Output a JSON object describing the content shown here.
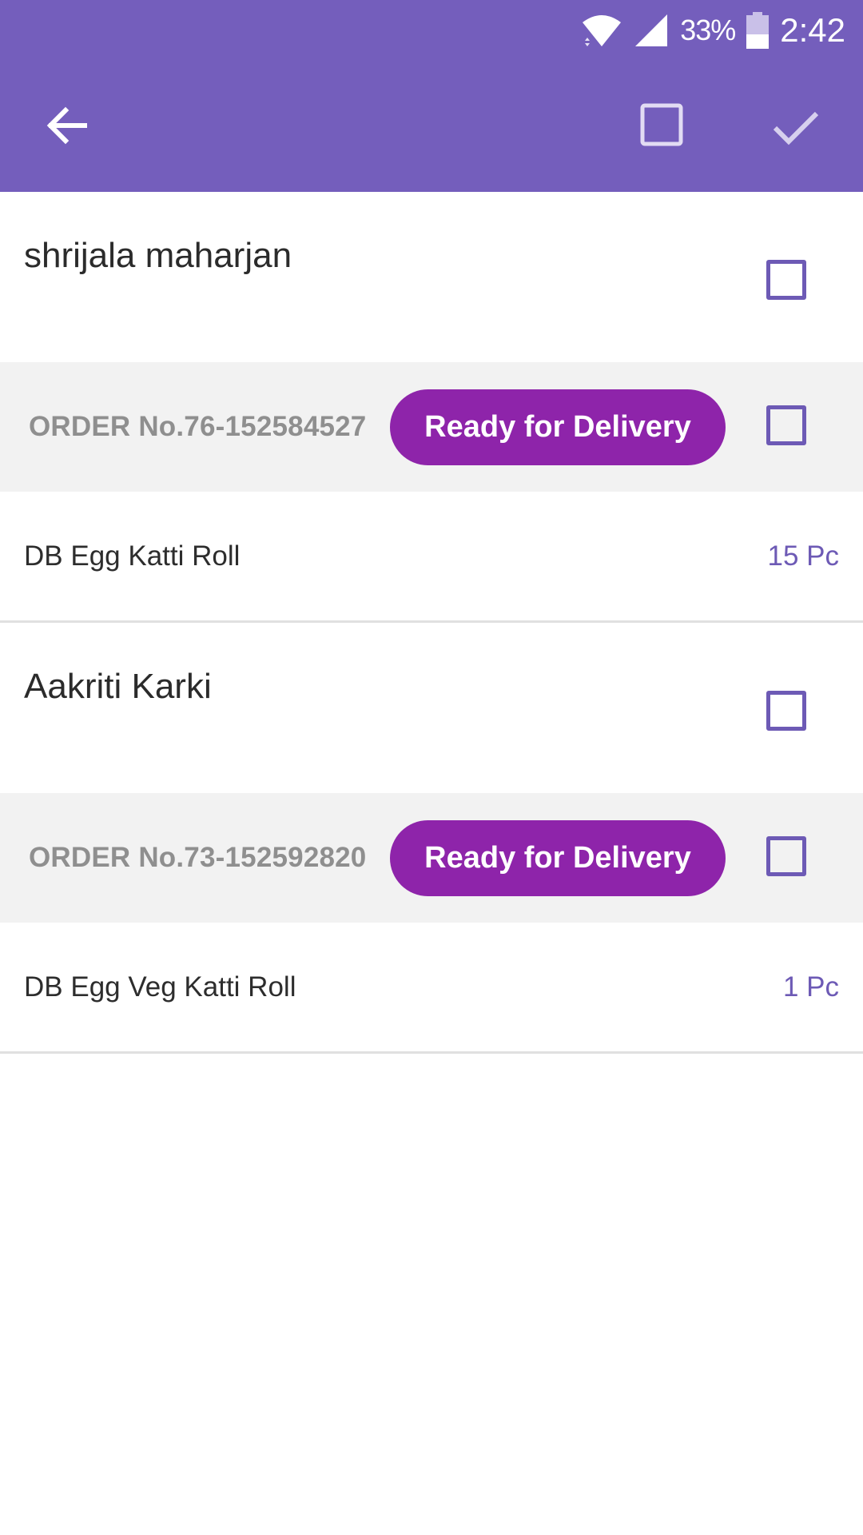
{
  "status_bar": {
    "battery_percent": "33%",
    "time": "2:42"
  },
  "app_bar": {
    "back_icon": "arrow-left-icon",
    "select_all_icon": "checkbox-outline-icon",
    "confirm_icon": "check-icon"
  },
  "orders": [
    {
      "customer": "shrijala maharjan",
      "order_no": "ORDER No.76-152584527",
      "status": "Ready for Delivery",
      "items": [
        {
          "name": "DB Egg Katti Roll",
          "qty": "15 Pc"
        }
      ]
    },
    {
      "customer": "Aakriti Karki",
      "order_no": "ORDER No.73-152592820",
      "status": "Ready for Delivery",
      "items": [
        {
          "name": "DB Egg Veg Katti Roll",
          "qty": "1 Pc"
        }
      ]
    }
  ],
  "colors": {
    "primary": "#745ebc",
    "badge": "#8e24aa",
    "checkbox": "#6d5ab5"
  }
}
